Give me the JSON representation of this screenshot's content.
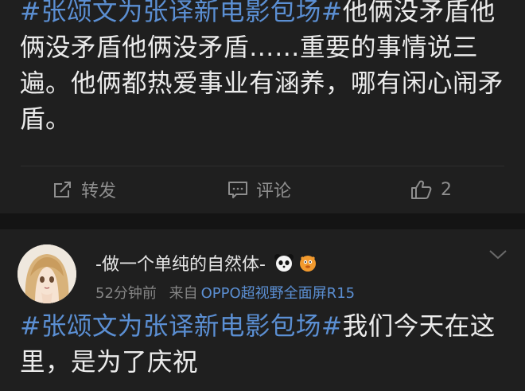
{
  "post1": {
    "hashtag": "#张颂文为张译新电影包场#",
    "text": "他俩没矛盾他俩没矛盾他俩没矛盾……重要的事情说三遍。他俩都热爱事业有涵养，哪有闲心闹矛盾。",
    "repost_label": "转发",
    "comment_label": "评论",
    "like_count": "2"
  },
  "post2": {
    "username": "-做一个单纯的自然体-",
    "time": "52分钟前",
    "source_prefix": "来自",
    "device": "OPPO超视野全面屏R15",
    "hashtag": "#张颂文为张译新电影包场#",
    "text": "我们今天在这里，是为了庆祝"
  },
  "icons": {
    "repost": "repost-icon",
    "comment": "comment-icon",
    "like": "thumbs-up-icon",
    "badge1": "panda-emoji-icon",
    "badge2": "orange-fish-emoji-icon",
    "more": "chevron-down-icon"
  },
  "colors": {
    "hashtag": "#5b8fd3",
    "background": "#1f1f1f",
    "text": "#ebebeb",
    "muted": "#8e8e8e"
  }
}
